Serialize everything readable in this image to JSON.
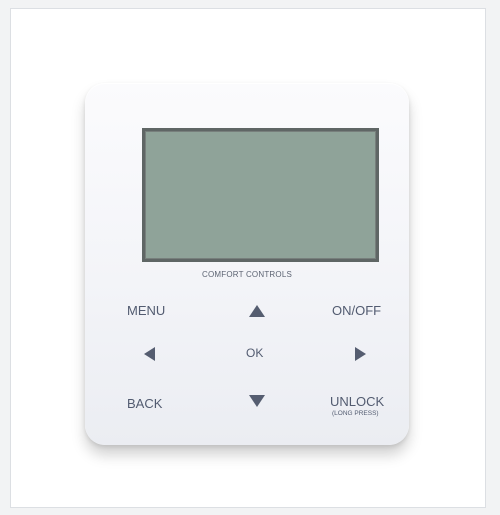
{
  "device": {
    "brand_label": "COMFORT CONTROLS"
  },
  "buttons": {
    "menu": "MENU",
    "on_off": "ON/OFF",
    "ok": "OK",
    "back": "BACK",
    "unlock": "UNLOCK",
    "unlock_hint": "(LONG PRESS)"
  },
  "icons": {
    "up": "up-arrow-icon",
    "down": "down-arrow-icon",
    "left": "left-arrow-icon",
    "right": "right-arrow-icon"
  },
  "colors": {
    "lcd": "#8fa399",
    "bezel": "#5f6665",
    "label": "#525b70"
  }
}
